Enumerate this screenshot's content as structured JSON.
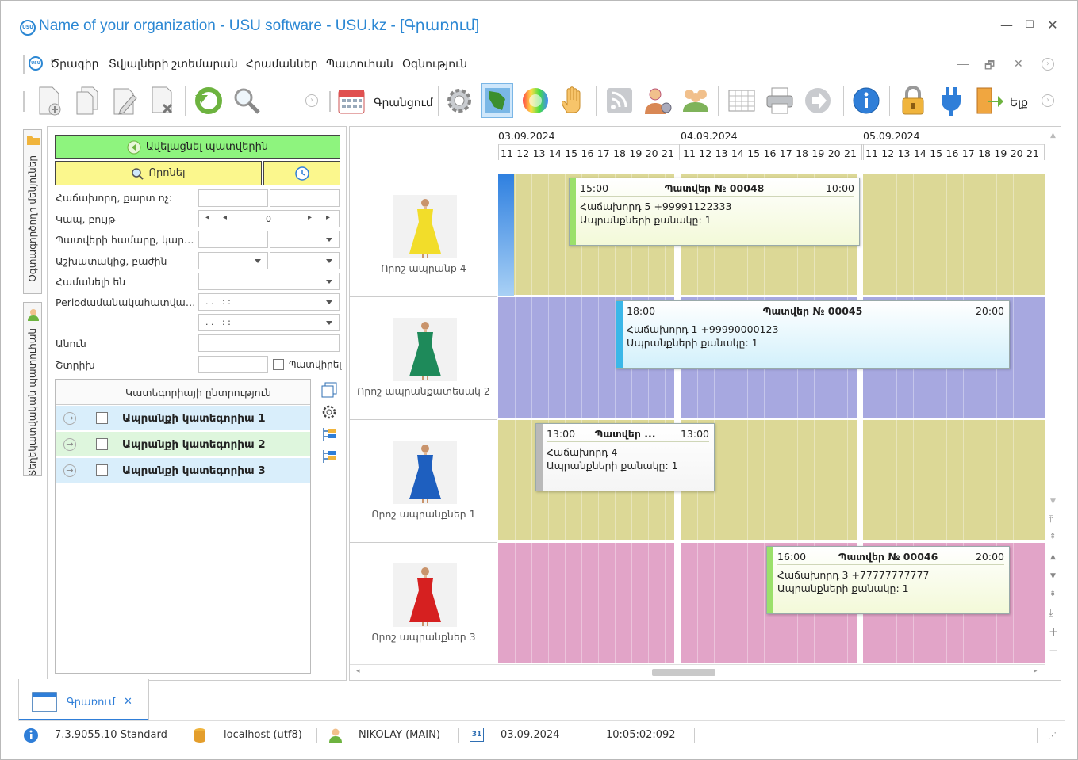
{
  "window": {
    "title": "Name of your organization - USU software - USU.kz - [Գրառում]",
    "logo_text": "USU",
    "controls": {
      "minimize": "—",
      "maximize": "☐",
      "close": "✕"
    }
  },
  "menu": {
    "items": [
      "Ծրագիր",
      "Տվյալների շտեմարան",
      "Հրամաններ",
      "Պատուհան",
      "Օգնություն"
    ],
    "mdi_controls": {
      "minimize": "—",
      "restore": "🗗",
      "close": "✕"
    }
  },
  "toolbar": {
    "calendar_label": "Գրանցում",
    "exit_label": "Ելք"
  },
  "side_tabs": {
    "tab1": "Օգտագործողի մենյուներ",
    "tab2": "Տեղեկատվական պատուհան"
  },
  "filter": {
    "refresh_label": "Ավելացնել պատվերին",
    "search_label": "Որոնել",
    "fields": [
      "Հաճախորդ, քարտ ոչ:",
      "Կապ, բույթ",
      "Պատվերի համարը, կարգ...",
      "Աշխատակից, բաժին",
      "Համանելի են",
      "Periodամանակահատվածում",
      "",
      "Անուն",
      "Շտրիխ"
    ],
    "stepper_value": "0",
    "date1": ". .   : :",
    "date2": ". .   : :",
    "ordered_checkbox_label": "Պատվիրել"
  },
  "category_grid": {
    "header": "Կատեգորիայի ընտրություն",
    "rows": [
      {
        "label": "Ապրանքի կատեգորիա 1",
        "color": "#d9eefb"
      },
      {
        "label": "Ապրանքի կատեգորիա 2",
        "color": "#def6dd"
      },
      {
        "label": "Ապրանքի կատեգորիա 3",
        "color": "#d9eefb"
      }
    ]
  },
  "schedule": {
    "dates": [
      "03.09.2024",
      "04.09.2024",
      "05.09.2024"
    ],
    "hours": [
      "11",
      "12",
      "13",
      "14",
      "15",
      "16",
      "17",
      "18",
      "19",
      "20",
      "21"
    ],
    "resources": [
      {
        "name": "Որոշ ապրանք 4",
        "lane_color": "#dcd896",
        "dress_color": "#f2dd2a"
      },
      {
        "name": "Որոշ ապրանքատեսակ 2",
        "lane_color": "#a7a8e0",
        "dress_color": "#1e8a5a"
      },
      {
        "name": "Որոշ ապրանքներ 1",
        "lane_color": "#dcd896",
        "dress_color": "#1e5fbf"
      },
      {
        "name": "Որոշ ապրանքներ 3",
        "lane_color": "#e2a4c8",
        "dress_color": "#d62020"
      }
    ],
    "appointments": [
      {
        "start": "15:00",
        "title": "Պատվեր № 00048",
        "end": "10:00",
        "client": "Հաճախորդ 5 +99991122333",
        "qty": "Ապրանքների քանակը: 1",
        "bar_color": "#9be06b",
        "bg": "#f3f9d8"
      },
      {
        "start": "18:00",
        "title": "Պատվեր № 00045",
        "end": "20:00",
        "client": "Հաճախորդ 1 +99990000123",
        "qty": "Ապրանքների քանակը: 1",
        "bar_color": "#3bb7e8",
        "bg": "#d2f0fb"
      },
      {
        "start": "13:00",
        "title": "Պատվեր ...",
        "end": "13:00",
        "client": "Հաճախորդ 4",
        "qty": "Ապրանքների քանակը: 1",
        "bar_color": "#b9b9b9",
        "bg": "#f5f5f5"
      },
      {
        "start": "16:00",
        "title": "Պատվեր № 00046",
        "end": "20:00",
        "client": "Հաճախորդ 3 +77777777777",
        "qty": "Ապրանքների քանակը: 1",
        "bar_color": "#9be06b",
        "bg": "#f3f9d8"
      }
    ]
  },
  "doc_tab": {
    "label": "Գրառում",
    "close": "✕"
  },
  "statusbar": {
    "version": "7.3.9055.10 Standard",
    "db": "localhost (utf8)",
    "user": "NIKOLAY (MAIN)",
    "date": "03.09.2024",
    "time": "10:05:02:092",
    "cal_day": "31"
  }
}
